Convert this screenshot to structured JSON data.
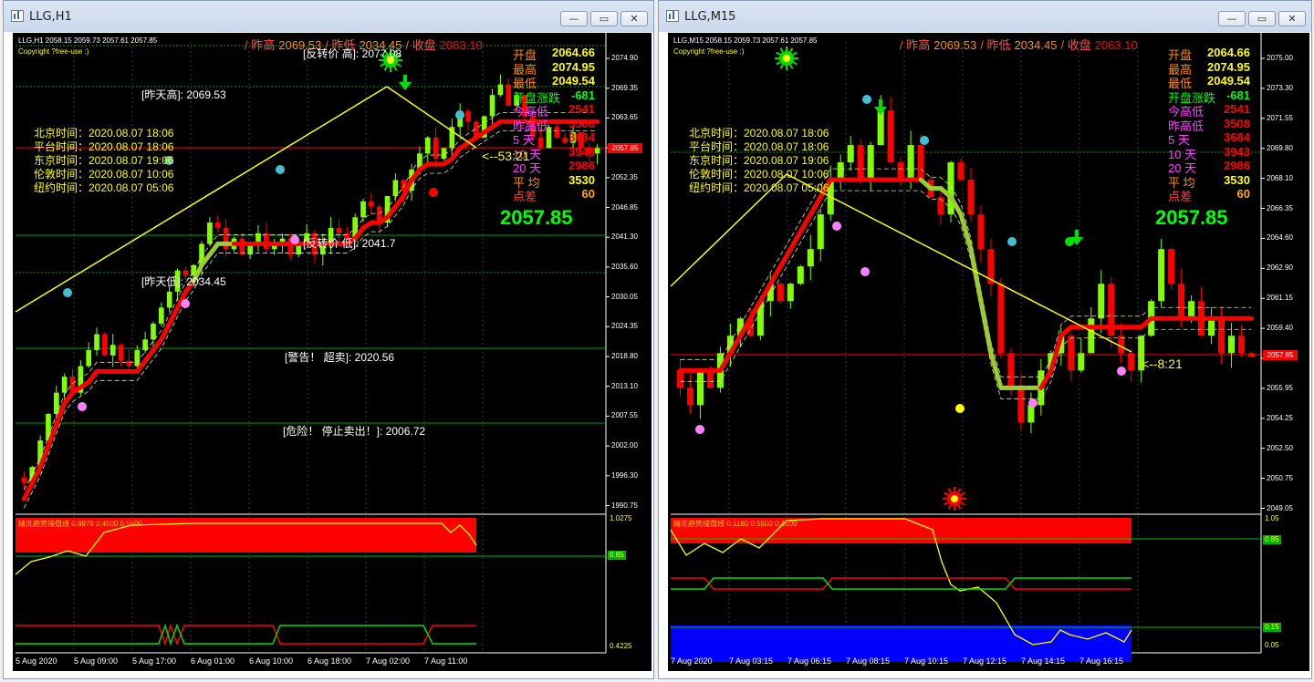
{
  "left": {
    "title": "LLG,H1",
    "header": "LLG,H1  2058.15 2059.73 2057.61 2057.85",
    "copyright": "Copyright ?free-use :)",
    "top_info": {
      "high_label": "/ 昨高",
      "high": "2069.53",
      "low_label": "/ 昨低",
      "low": "2034.45",
      "close_label": "/ 收盘",
      "close": "2063.10"
    },
    "panel": [
      {
        "label": "开盘",
        "value": "2064.66"
      },
      {
        "label": "最高",
        "value": "2074.95"
      },
      {
        "label": "最低",
        "value": "2049.54"
      },
      {
        "label": "开盘涨跌",
        "value": "-681"
      },
      {
        "label": "今高低",
        "value": "2541"
      },
      {
        "label": "昨高低",
        "value": "3508"
      },
      {
        "label": "5  天",
        "value": "3684"
      },
      {
        "label": "10  天",
        "value": "3943"
      },
      {
        "label": "20  天",
        "value": "2986"
      },
      {
        "label": "平  均",
        "value": "3530"
      },
      {
        "label": "点差",
        "value": "60"
      }
    ],
    "big_price": "2057.85",
    "timer": "<--53:21",
    "times": [
      "北京时间：2020.08.07 18:06",
      "平台时间：2020.08.07 18:06",
      "东京时间：2020.08.07 19:06",
      "伦敦时间：2020.08.07 10:06",
      "纽约时间：2020.08.07 05:06"
    ],
    "annotations": {
      "reversal_high": "[反转价 高]: 2077.08",
      "prev_high": "[昨天高]: 2069.53",
      "reversal_low": "[反转价 低]: 2041.7",
      "prev_low": "[昨天低]: 2034.45",
      "warning": "[警告！ 超卖]: 2020.56",
      "danger": "[危险！ 停止卖出！]: 2006.72"
    },
    "y_labels": [
      "2074.90",
      "2069.35",
      "2063.65",
      "2057.85",
      "2052.35",
      "2046.85",
      "2041.30",
      "2035.60",
      "2030.05",
      "2024.35",
      "2018.80",
      "2013.10",
      "2007.55",
      "2002.00",
      "1996.30",
      "1990.75"
    ],
    "current_price_tag": "2057.85",
    "sub_indicator": "精准趋势操盘线  0.8978 0.4500 0.5500",
    "sub_labels": [
      "1.0275",
      "0.85",
      "0.4225"
    ],
    "x_labels": [
      "5 Aug 2020",
      "5 Aug 09:00",
      "5 Aug 17:00",
      "6 Aug 01:00",
      "6 Aug 10:00",
      "6 Aug 18:00",
      "7 Aug 02:00",
      "7 Aug 11:00"
    ]
  },
  "right": {
    "title": "LLG,M15",
    "header": "LLG,M15  2058.15 2059.73 2057.61 2057.85",
    "copyright": "Copyright ?free-use :)",
    "top_info": {
      "high_label": "/ 昨高",
      "high": "2069.53",
      "low_label": "/ 昨低",
      "low": "2034.45",
      "close_label": "/ 收盘",
      "close": "2063.10"
    },
    "panel": [
      {
        "label": "开盘",
        "value": "2064.66"
      },
      {
        "label": "最高",
        "value": "2074.95"
      },
      {
        "label": "最低",
        "value": "2049.54"
      },
      {
        "label": "开盘涨跌",
        "value": "-681"
      },
      {
        "label": "今高低",
        "value": "2541"
      },
      {
        "label": "昨高低",
        "value": "3508"
      },
      {
        "label": "5  天",
        "value": "3684"
      },
      {
        "label": "10  天",
        "value": "3943"
      },
      {
        "label": "20  天",
        "value": "2986"
      },
      {
        "label": "平  均",
        "value": "3530"
      },
      {
        "label": "点差",
        "value": "60"
      }
    ],
    "big_price": "2057.85",
    "timer": "<--8:21",
    "times": [
      "北京时间：2020.08.07 18:06",
      "平台时间：2020.08.07 18:06",
      "东京时间：2020.08.07 19:06",
      "伦敦时间：2020.08.07 10:06",
      "纽约时间：2020.08.07 05:06"
    ],
    "y_labels": [
      "2075.00",
      "2073.30",
      "2071.55",
      "2069.80",
      "2068.10",
      "2066.35",
      "2064.60",
      "2062.90",
      "2061.15",
      "2059.40",
      "2057.85",
      "2055.95",
      "2054.25",
      "2052.50",
      "2050.75",
      "2049.05"
    ],
    "current_price_tag": "2057.85",
    "sub_indicator": "精准趋势操盘线  0.1180 0.5500 0.4500",
    "sub_labels": [
      "1.05",
      "0.85",
      "0.15",
      "0.05"
    ],
    "x_labels": [
      "7 Aug 2020",
      "7 Aug 03:15",
      "7 Aug 06:15",
      "7 Aug 08:15",
      "7 Aug 10:15",
      "7 Aug 12:15",
      "7 Aug 14:15",
      "7 Aug 16:15"
    ]
  },
  "window_buttons": {
    "minimize": "—",
    "maximize": "▭",
    "close": "✕"
  },
  "colors": {
    "bull": "#7fff00",
    "bear": "#ff0000",
    "trend": "#ff0000",
    "trendline": "#ffff00",
    "panel_value": "#ffff00",
    "big_price": "#00ff00"
  }
}
